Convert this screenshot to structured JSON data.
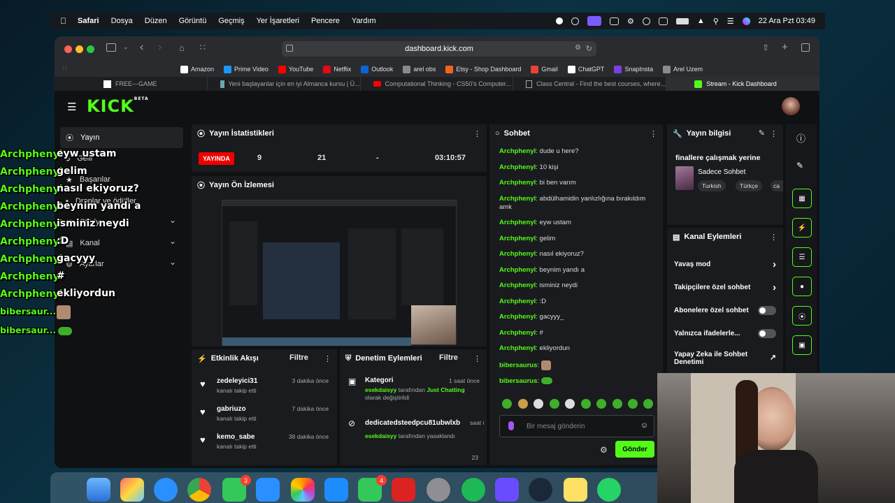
{
  "menubar": {
    "items": [
      "Safari",
      "Dosya",
      "Düzen",
      "Görüntü",
      "Geçmiş",
      "Yer İşaretleri",
      "Pencere",
      "Yardım"
    ],
    "clock": "22 Ara Pzt 03:49"
  },
  "browser": {
    "address": "dashboard.kick.com",
    "bookmarks": [
      {
        "label": "Amazon",
        "color": "#ffffff"
      },
      {
        "label": "Prime Video",
        "color": "#1a98ff"
      },
      {
        "label": "YouTube",
        "color": "#ff0000"
      },
      {
        "label": "Netflix",
        "color": "#e50914"
      },
      {
        "label": "Outlook",
        "color": "#0a64d6"
      },
      {
        "label": "arel obs",
        "color": "#8a8a8a"
      },
      {
        "label": "Etsy - Shop Dashboard",
        "color": "#f1641e"
      },
      {
        "label": "Gmail",
        "color": "#ea4335"
      },
      {
        "label": "ChatGPT",
        "color": "#ffffff"
      },
      {
        "label": "SnapInsta",
        "color": "#7b3fe4"
      },
      {
        "label": "Arel Uzem",
        "color": "#8a8a8a"
      }
    ],
    "tabs": [
      "FREE---GAME",
      "Yeni başlayanlar için en iyi Almanca kursu | Ü...",
      "Computational Thinking - CS50's Computer...",
      "Class Central - Find the best courses, where...",
      "Stream - Kick Dashboard"
    ]
  },
  "kick": {
    "logo": "KICK",
    "logo_badge": "BETA",
    "nav": {
      "items": [
        "Yayın",
        "Gelir",
        "Başarılar",
        "Droplar ve ödüller",
        "Stüdyo",
        "Kanal",
        "Ayarlar"
      ]
    },
    "stats": {
      "title": "Yayın İstatistikleri",
      "live_badge": "YAYINDA",
      "viewers": "9",
      "followers": "21",
      "dash": "-",
      "duration": "03:10:57"
    },
    "preview": {
      "title": "Yayın Ön İzlemesi"
    },
    "activity": {
      "title": "Etkinlik Akışı",
      "filter": "Filtre",
      "items": [
        {
          "user": "zedeleyici31",
          "time": "3 dakika önce",
          "action": "kanalı takip etti"
        },
        {
          "user": "gabriuzo",
          "time": "7 dakika önce",
          "action": "kanalı takip etti"
        },
        {
          "user": "kemo_sabe",
          "time": "38 dakika önce",
          "action": "kanalı takip etti"
        }
      ]
    },
    "moderation": {
      "title": "Denetim Eylemleri",
      "filter": "Filtre",
      "items": [
        {
          "title": "Kategori",
          "time": "1 saat önce",
          "actor": "esekdaisyy",
          "mid": " tarafından ",
          "target": "Just Chatting",
          "rest": "olarak değiştirildi"
        },
        {
          "title": "dedicatedsteedpcu81ubwlxb",
          "time": "saat önce",
          "actor": "esekdaisyy",
          "mid": " tarafından yasaklandı",
          "target": "",
          "rest": ""
        }
      ],
      "footer_num": "23"
    },
    "chat": {
      "title": "Sohbet",
      "messages": [
        {
          "user": "Archphenyl",
          "text": "dude u here?"
        },
        {
          "user": "Archphenyl",
          "text": "10 kişi"
        },
        {
          "user": "Archphenyl",
          "text": "bi ben varım"
        },
        {
          "user": "Archphenyl",
          "text": "abdülhamidin yanlızlığına bırakıldım amk"
        },
        {
          "user": "Archphenyl",
          "text": "eyw ustam"
        },
        {
          "user": "Archphenyl",
          "text": "gelim"
        },
        {
          "user": "Archphenyl",
          "text": "nasıl ekiyoruz?"
        },
        {
          "user": "Archphenyl",
          "text": "beynim yandı a"
        },
        {
          "user": "Archphenyl",
          "text": "isminiz neydi"
        },
        {
          "user": "Archphenyl",
          "text": ":D"
        },
        {
          "user": "Archphenyl",
          "text": "gacyyy_"
        },
        {
          "user": "Archphenyl",
          "text": "#"
        },
        {
          "user": "Archphenyl",
          "text": "ekliyordun"
        },
        {
          "user": "bibersaurus",
          "text": ""
        },
        {
          "user": "bibersaurus",
          "text": ""
        }
      ],
      "input_placeholder": "Bir mesaj gönderin",
      "send": "Gönder"
    },
    "stream_info": {
      "title": "Yayın bilgisi",
      "stream_title": "finallere çalışmak yerine",
      "category": "Sadece Sohbet",
      "tags": [
        "Turkish",
        "Türkçe",
        "ca"
      ]
    },
    "channel_actions": {
      "title": "Kanal Eylemleri",
      "items": [
        {
          "label": "Yavaş mod",
          "kind": "chevron"
        },
        {
          "label": "Takipçilere özel sohbet",
          "kind": "chevron"
        },
        {
          "label": "Abonelere özel sohbet",
          "kind": "toggle"
        },
        {
          "label": "Yalnızca ifadelerle...",
          "kind": "toggle"
        },
        {
          "label": "Yapay Zeka ile Sohbet Denetimi",
          "kind": "link"
        }
      ]
    }
  },
  "overlay": {
    "messages": [
      {
        "user": "Archphenyl",
        "text": "eyw ustam"
      },
      {
        "user": "Archphenyl",
        "text": "gelim"
      },
      {
        "user": "Archphenyl",
        "text": "nasıl ekiyoruz?"
      },
      {
        "user": "Archphenyl",
        "text": "beynim yandı a"
      },
      {
        "user": "Archphenyl",
        "text": "isminiz neydi"
      },
      {
        "user": "Archphenyl",
        "text": ":D"
      },
      {
        "user": "Archphenyl",
        "text": "gacyyy"
      },
      {
        "user": "Archphenyl",
        "text": "#"
      },
      {
        "user": "Archphenyl",
        "text": "ekliyordun"
      },
      {
        "user": "bibersaur...",
        "text": ""
      },
      {
        "user": "bibersaur...",
        "text": ""
      }
    ]
  },
  "dock": {
    "badges": {
      "messages": "3",
      "facetime": "4"
    }
  }
}
